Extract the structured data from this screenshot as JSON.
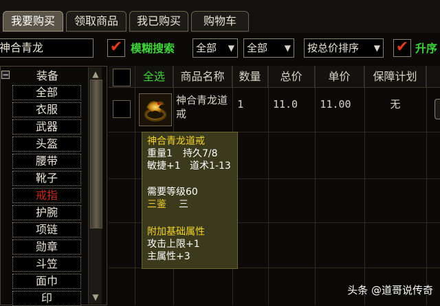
{
  "tabs": [
    {
      "label": "我要购买",
      "active": true
    },
    {
      "label": "领取商品",
      "active": false
    },
    {
      "label": "我已购买",
      "active": false
    },
    {
      "label": "购物车",
      "active": false
    }
  ],
  "search": {
    "value": "神合青龙",
    "fuzzy_checked": true,
    "fuzzy_label": "模糊搜索",
    "filter1": "全部",
    "filter2": "全部",
    "sort": "按总价排序",
    "asc_checked": true,
    "asc_label": "升序"
  },
  "categories": {
    "header": "装备",
    "items": [
      "全部",
      "衣服",
      "武器",
      "头盔",
      "腰带",
      "靴子",
      "戒指",
      "护腕",
      "项链",
      "勋章",
      "斗笠",
      "面巾",
      "印"
    ],
    "active_index": 6
  },
  "table": {
    "select_all": "全选",
    "columns": [
      "商品名称",
      "数量",
      "总价",
      "单价",
      "保障计划"
    ],
    "rows": [
      {
        "name": "神合青龙道戒",
        "qty": "1",
        "total": "11.0",
        "unit": "11.00",
        "guarantee": "无"
      }
    ]
  },
  "tooltip": {
    "title": "神合青龙道戒",
    "weight": "重量1",
    "durability": "持久7/8",
    "agility": "敏捷+1",
    "taoism": "道术1-13",
    "req_level": "需要等级60",
    "appraise_label": "三鉴",
    "appraise_value": "三",
    "attr_title": "附加基础属性",
    "attr1": "攻击上限+1",
    "attr2": "主属性+3"
  },
  "watermark": "头条 @道哥说传奇",
  "colors": {
    "accent_green": "#3fd23a",
    "check_red": "#e23a1e",
    "active_cat": "#c8281a",
    "tooltip_title": "#f2d22a"
  }
}
